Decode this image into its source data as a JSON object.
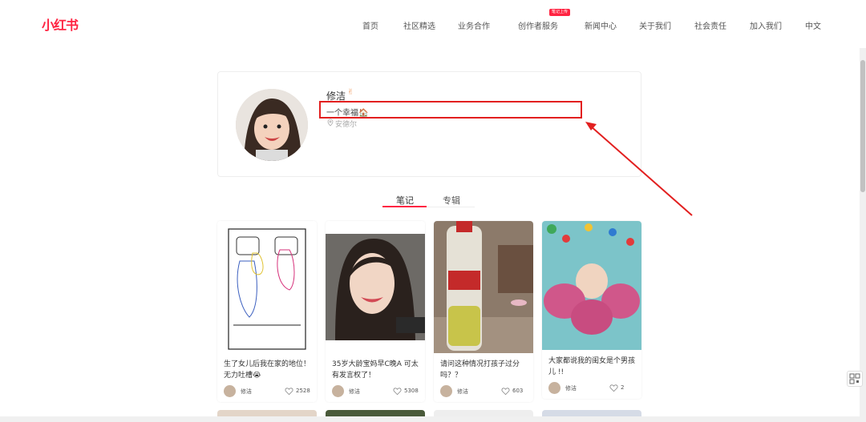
{
  "header": {
    "logo": "小红书",
    "nav": [
      {
        "label": "首页"
      },
      {
        "label": "社区精选"
      },
      {
        "label": "业务合作"
      },
      {
        "label": "创作者服务"
      },
      {
        "label": "新闻中心"
      },
      {
        "label": "关于我们"
      },
      {
        "label": "社会责任"
      },
      {
        "label": "加入我们"
      },
      {
        "label": "中文"
      }
    ],
    "badge": "笔记上传"
  },
  "profile": {
    "name": "修洁",
    "name_icon": "hand-emoji",
    "bio": "一个幸福🏠",
    "location": "安德尔"
  },
  "tabs": [
    {
      "label": "笔记"
    },
    {
      "label": "专辑"
    }
  ],
  "cards": [
    {
      "title": "生了女儿后我在家的地位！无力吐槽😭",
      "author": "修洁",
      "likes": "2528"
    },
    {
      "title": "35岁大龄宝妈早C晚A 可太有发言权了！",
      "author": "修洁",
      "likes": "5308"
    },
    {
      "title": "请问这种情况打孩子过分吗？？",
      "author": "修洁",
      "likes": "603"
    },
    {
      "title": "大家都说我的闺女是个男孩儿 !!",
      "author": "修洁",
      "likes": "2"
    }
  ],
  "colors": {
    "accent": "#ff2442",
    "annotation": "#e21f1f"
  }
}
